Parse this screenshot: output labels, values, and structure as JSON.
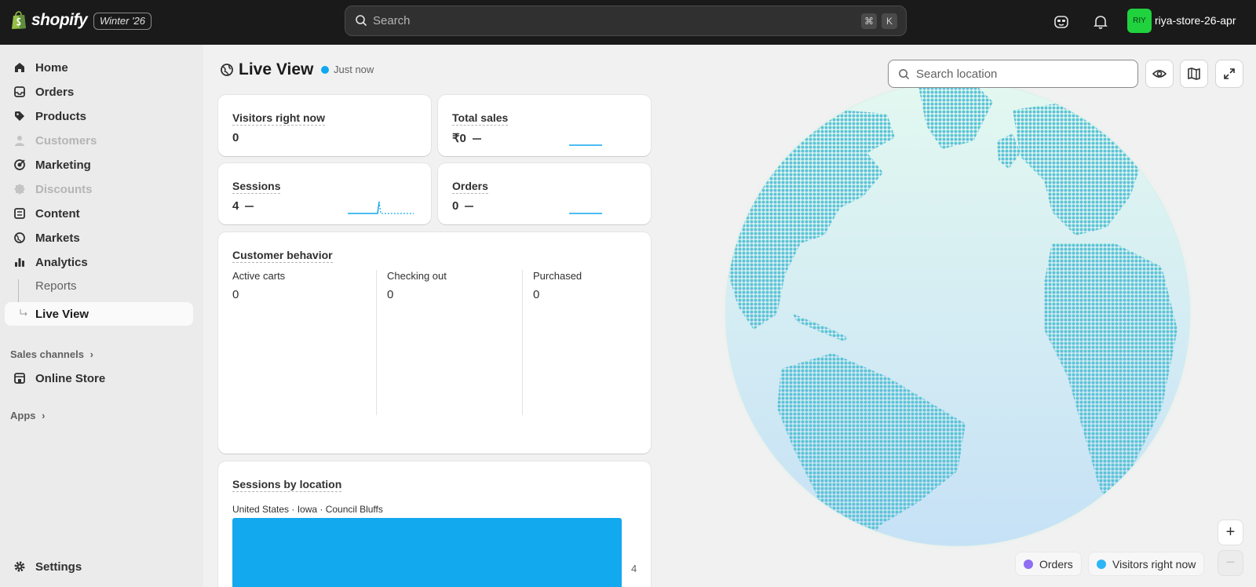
{
  "topbar": {
    "brand": "shopify",
    "edition": "Winter '26",
    "search_placeholder": "Search",
    "shortcut_keys": [
      "⌘",
      "K"
    ],
    "avatar_initials": "RIY",
    "store_name": "riya-store-26-apr"
  },
  "sidebar": {
    "items": [
      {
        "label": "Home",
        "icon": "home-icon"
      },
      {
        "label": "Orders",
        "icon": "inbox-icon"
      },
      {
        "label": "Products",
        "icon": "tag-icon"
      },
      {
        "label": "Customers",
        "icon": "person-icon",
        "disabled": true
      },
      {
        "label": "Marketing",
        "icon": "target-icon"
      },
      {
        "label": "Discounts",
        "icon": "discount-icon",
        "disabled": true
      },
      {
        "label": "Content",
        "icon": "content-icon"
      },
      {
        "label": "Markets",
        "icon": "globe-icon"
      },
      {
        "label": "Analytics",
        "icon": "chart-icon"
      },
      {
        "label": "Reports",
        "sub": true
      },
      {
        "label": "Live View",
        "sub": true,
        "active": true
      }
    ],
    "sales_channels_label": "Sales channels",
    "online_store_label": "Online Store",
    "apps_label": "Apps",
    "settings_label": "Settings"
  },
  "page": {
    "title": "Live View",
    "status": "Just now"
  },
  "cards": {
    "visitors": {
      "title": "Visitors right now",
      "value": "0"
    },
    "total_sales": {
      "title": "Total sales",
      "value": "₹0"
    },
    "sessions": {
      "title": "Sessions",
      "value": "4"
    },
    "orders": {
      "title": "Orders",
      "value": "0"
    },
    "customer_behavior": {
      "title": "Customer behavior",
      "columns": [
        {
          "label": "Active carts",
          "value": "0"
        },
        {
          "label": "Checking out",
          "value": "0"
        },
        {
          "label": "Purchased",
          "value": "0"
        }
      ]
    },
    "sessions_by_location": {
      "title": "Sessions by location",
      "location": "United States · Iowa · Council Bluffs",
      "value": "4"
    }
  },
  "globe": {
    "search_placeholder": "Search location",
    "legend": [
      {
        "label": "Orders",
        "color": "#8f6df4"
      },
      {
        "label": "Visitors right now",
        "color": "#2db6f5"
      }
    ],
    "zoom_in": "+",
    "zoom_out": "−"
  },
  "colors": {
    "accent": "#11a7ee",
    "avatar": "#20d23e"
  }
}
